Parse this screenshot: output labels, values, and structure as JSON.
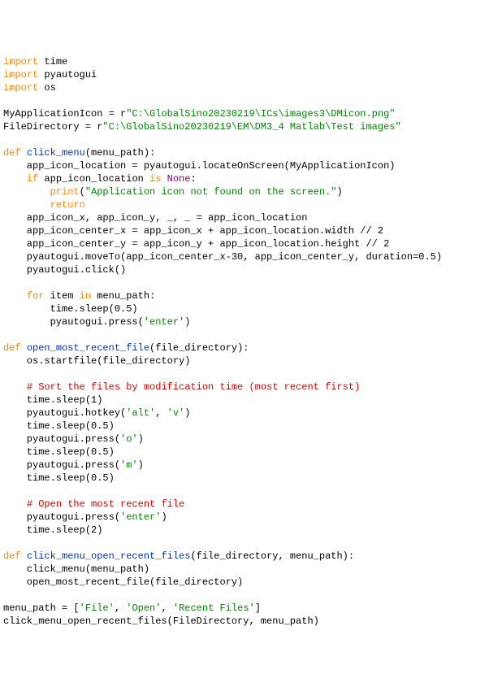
{
  "code": {
    "tokens": [
      [
        [
          "kw",
          "import"
        ],
        [
          "pl",
          " time"
        ]
      ],
      [
        [
          "kw",
          "import"
        ],
        [
          "pl",
          " pyautogui"
        ]
      ],
      [
        [
          "kw",
          "import"
        ],
        [
          "pl",
          " os"
        ]
      ],
      [],
      [
        [
          "pl",
          "MyApplicationIcon = r"
        ],
        [
          "str",
          "\"C:\\GlobalSino20230219\\ICs\\images3\\DMicon.png\""
        ]
      ],
      [
        [
          "pl",
          "FileDirectory = r"
        ],
        [
          "str",
          "\"C:\\GlobalSino20230219\\EM\\DM3_4 Matlab\\Test images\""
        ]
      ],
      [],
      [
        [
          "kw",
          "def"
        ],
        [
          "pl",
          " "
        ],
        [
          "nm",
          "click_menu"
        ],
        [
          "pl",
          "(menu_path):"
        ]
      ],
      [
        [
          "pl",
          "    app_icon_location = pyautogui.locateOnScreen(MyApplicationIcon)"
        ]
      ],
      [
        [
          "pl",
          "    "
        ],
        [
          "kw",
          "if"
        ],
        [
          "pl",
          " app_icon_location "
        ],
        [
          "kw",
          "is"
        ],
        [
          "pl",
          " "
        ],
        [
          "none",
          "None"
        ],
        [
          "pl",
          ":"
        ]
      ],
      [
        [
          "pl",
          "        "
        ],
        [
          "kw",
          "print"
        ],
        [
          "pl",
          "("
        ],
        [
          "str",
          "\"Application icon not found on the screen.\""
        ],
        [
          "pl",
          ")"
        ]
      ],
      [
        [
          "pl",
          "        "
        ],
        [
          "kw",
          "return"
        ]
      ],
      [
        [
          "pl",
          "    app_icon_x, app_icon_y, _, _ = app_icon_location"
        ]
      ],
      [
        [
          "pl",
          "    app_icon_center_x = app_icon_x + app_icon_location.width // 2"
        ]
      ],
      [
        [
          "pl",
          "    app_icon_center_y = app_icon_y + app_icon_location.height // 2"
        ]
      ],
      [
        [
          "pl",
          "    pyautogui.moveTo(app_icon_center_x-30, app_icon_center_y, duration=0.5)"
        ]
      ],
      [
        [
          "pl",
          "    pyautogui.click()"
        ]
      ],
      [],
      [
        [
          "pl",
          "    "
        ],
        [
          "kw",
          "for"
        ],
        [
          "pl",
          " item "
        ],
        [
          "kw",
          "in"
        ],
        [
          "pl",
          " menu_path:"
        ]
      ],
      [
        [
          "pl",
          "        time.sleep(0.5)"
        ]
      ],
      [
        [
          "pl",
          "        pyautogui.press("
        ],
        [
          "str",
          "'enter'"
        ],
        [
          "pl",
          ")"
        ]
      ],
      [],
      [
        [
          "kw",
          "def"
        ],
        [
          "pl",
          " "
        ],
        [
          "nm",
          "open_most_recent_file"
        ],
        [
          "pl",
          "(file_directory):"
        ]
      ],
      [
        [
          "pl",
          "    os.startfile(file_directory)"
        ]
      ],
      [],
      [
        [
          "pl",
          "    "
        ],
        [
          "com",
          "# Sort the files by modification time (most recent first)"
        ]
      ],
      [
        [
          "pl",
          "    time.sleep(1)"
        ]
      ],
      [
        [
          "pl",
          "    pyautogui.hotkey("
        ],
        [
          "str",
          "'alt'"
        ],
        [
          "pl",
          ", "
        ],
        [
          "str",
          "'v'"
        ],
        [
          "pl",
          ")"
        ]
      ],
      [
        [
          "pl",
          "    time.sleep(0.5)"
        ]
      ],
      [
        [
          "pl",
          "    pyautogui.press("
        ],
        [
          "str",
          "'o'"
        ],
        [
          "pl",
          ")"
        ]
      ],
      [
        [
          "pl",
          "    time.sleep(0.5)"
        ]
      ],
      [
        [
          "pl",
          "    pyautogui.press("
        ],
        [
          "str",
          "'m'"
        ],
        [
          "pl",
          ")"
        ]
      ],
      [
        [
          "pl",
          "    time.sleep(0.5)"
        ]
      ],
      [],
      [
        [
          "pl",
          "    "
        ],
        [
          "com",
          "# Open the most recent file"
        ]
      ],
      [
        [
          "pl",
          "    pyautogui.press("
        ],
        [
          "str",
          "'enter'"
        ],
        [
          "pl",
          ")"
        ]
      ],
      [
        [
          "pl",
          "    time.sleep(2)"
        ]
      ],
      [],
      [
        [
          "kw",
          "def"
        ],
        [
          "pl",
          " "
        ],
        [
          "nm",
          "click_menu_open_recent_files"
        ],
        [
          "pl",
          "(file_directory, menu_path):"
        ]
      ],
      [
        [
          "pl",
          "    click_menu(menu_path)"
        ]
      ],
      [
        [
          "pl",
          "    open_most_recent_file(file_directory)"
        ]
      ],
      [],
      [
        [
          "pl",
          "menu_path = ["
        ],
        [
          "str",
          "'File'"
        ],
        [
          "pl",
          ", "
        ],
        [
          "str",
          "'Open'"
        ],
        [
          "pl",
          ", "
        ],
        [
          "str",
          "'Recent Files'"
        ],
        [
          "pl",
          "]"
        ]
      ],
      [
        [
          "pl",
          "click_menu_open_recent_files(FileDirectory, menu_path)"
        ]
      ]
    ]
  }
}
